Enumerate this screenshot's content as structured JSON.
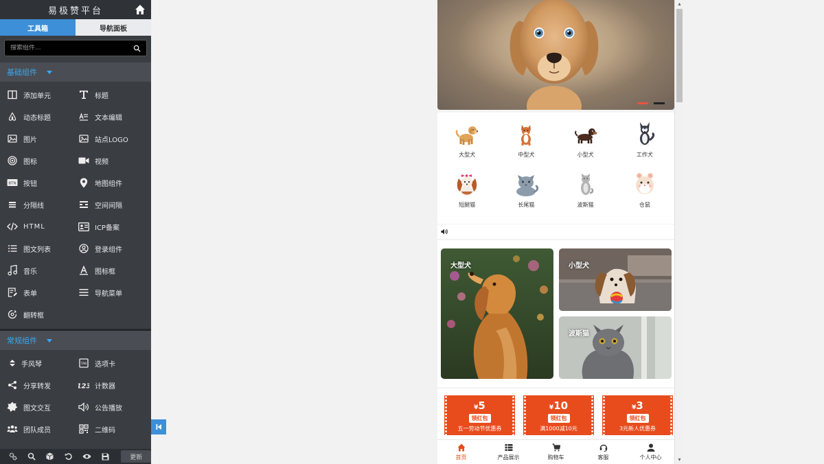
{
  "sidebar": {
    "title": "易极赞平台",
    "tabs": [
      {
        "label": "工具箱",
        "active": true
      },
      {
        "label": "导航面板",
        "active": false
      }
    ],
    "search_placeholder": "搜索组件...",
    "sections": [
      {
        "title": "基础组件",
        "items": [
          {
            "label": "添加单元",
            "icon": "layout-columns-icon"
          },
          {
            "label": "标题",
            "icon": "text-title-icon"
          },
          {
            "label": "动态标题",
            "icon": "airbnb-logo-icon"
          },
          {
            "label": "文本编辑",
            "icon": "text-edit-icon"
          },
          {
            "label": "图片",
            "icon": "image-icon"
          },
          {
            "label": "站点LOGO",
            "icon": "logo-image-icon"
          },
          {
            "label": "图标",
            "icon": "bullseye-icon"
          },
          {
            "label": "视频",
            "icon": "video-camera-icon"
          },
          {
            "label": "按钮",
            "icon": "btn-icon"
          },
          {
            "label": "地图组件",
            "icon": "map-pin-icon"
          },
          {
            "label": "分隔线",
            "icon": "divider-icon"
          },
          {
            "label": "空间间隔",
            "icon": "spacer-icon"
          },
          {
            "label": "HTML",
            "icon": "code-icon"
          },
          {
            "label": "ICP备案",
            "icon": "id-card-icon"
          },
          {
            "label": "图文列表",
            "icon": "list-icon"
          },
          {
            "label": "登录组件",
            "icon": "user-circle-icon"
          },
          {
            "label": "音乐",
            "icon": "music-note-icon"
          },
          {
            "label": "图标框",
            "icon": "font-a-icon"
          },
          {
            "label": "表单",
            "icon": "form-icon"
          },
          {
            "label": "导航菜单",
            "icon": "menu-icon"
          },
          {
            "label": "翻转框",
            "icon": "flip-icon"
          }
        ]
      },
      {
        "title": "常规组件",
        "items": [
          {
            "label": "手风琴",
            "icon": "accordion-icon"
          },
          {
            "label": "选项卡",
            "icon": "tab-icon"
          },
          {
            "label": "分享转发",
            "icon": "share-icon"
          },
          {
            "label": "计数器",
            "icon": "counter-123-icon"
          },
          {
            "label": "图文交互",
            "icon": "star-badge-icon"
          },
          {
            "label": "公告播放",
            "icon": "speaker-icon"
          },
          {
            "label": "团队成员",
            "icon": "team-icon"
          },
          {
            "label": "二维码",
            "icon": "qrcode-icon"
          }
        ]
      }
    ],
    "bottom_toolbar": {
      "icons": [
        "cogs-icon",
        "search-icon",
        "cube-icon",
        "undo-icon",
        "eye-icon",
        "save-icon"
      ],
      "update_label": "更新"
    }
  },
  "preview": {
    "hero": {
      "slide_count": 2,
      "active_slide": 0
    },
    "categories": [
      {
        "label": "大型犬"
      },
      {
        "label": "中型犬"
      },
      {
        "label": "小型犬"
      },
      {
        "label": "工作犬"
      },
      {
        "label": "短腿猫"
      },
      {
        "label": "长尾猫"
      },
      {
        "label": "波斯猫"
      },
      {
        "label": "仓鼠"
      }
    ],
    "pictures": [
      {
        "label": "大型犬"
      },
      {
        "label": "小型犬"
      },
      {
        "label": "波斯猫"
      }
    ],
    "coupons": [
      {
        "currency": "¥",
        "amount": "5",
        "button": "领红包",
        "desc": "五一劳动节优惠券"
      },
      {
        "currency": "¥",
        "amount": "10",
        "button": "领红包",
        "desc": "满1000减10元"
      },
      {
        "currency": "¥",
        "amount": "3",
        "button": "领红包",
        "desc": "3元新人优惠券"
      }
    ],
    "bottom_nav": [
      {
        "label": "首页",
        "icon": "home-icon",
        "active": true
      },
      {
        "label": "产品展示",
        "icon": "grid-list-icon",
        "active": false
      },
      {
        "label": "购物车",
        "icon": "cart-icon",
        "active": false
      },
      {
        "label": "客服",
        "icon": "headset-icon",
        "active": false
      },
      {
        "label": "个人中心",
        "icon": "user-icon",
        "active": false
      }
    ]
  },
  "colors": {
    "sidebar_bg": "#3a3d42",
    "accent_blue": "#3d8fd7",
    "section_title": "#3da6ee",
    "coupon_red": "#e84c1c"
  }
}
